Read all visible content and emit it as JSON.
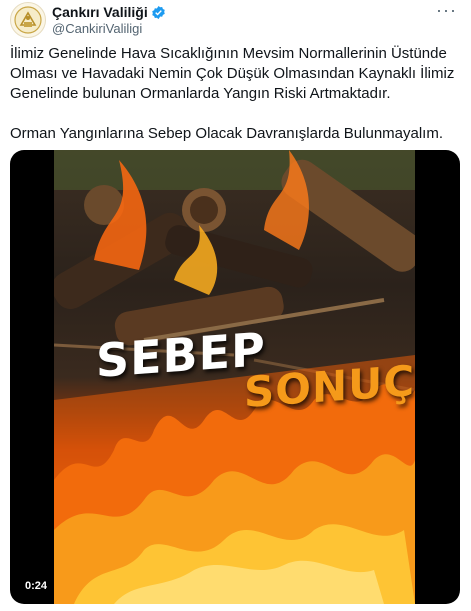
{
  "author": {
    "display_name": "Çankırı Valiliği",
    "handle": "@CankiriValiligi",
    "verified_icon": "verified-badge-icon",
    "avatar_icon": "government-seal-icon"
  },
  "more_icon": "more-options-icon",
  "tweet": {
    "paragraph1": "İlimiz Genelinde Hava Sıcaklığının Mevsim Normallerinin Üstünde Olması ve Havadaki Nemin Çok Düşük Olmasından Kaynaklı İlimiz Genelinde bulunan Ormanlarda Yangın Riski Artmaktadır.",
    "paragraph2": "Orman Yangınlarına Sebep Olacak Davranışlarda Bulunmayalım."
  },
  "media": {
    "word1": "SEBEP",
    "word2": "SONUÇ",
    "duration": "0:24"
  },
  "colors": {
    "verified": "#1d9bf0",
    "text": "#0f1419",
    "muted": "#536471",
    "accent_orange": "#f59a1a"
  }
}
